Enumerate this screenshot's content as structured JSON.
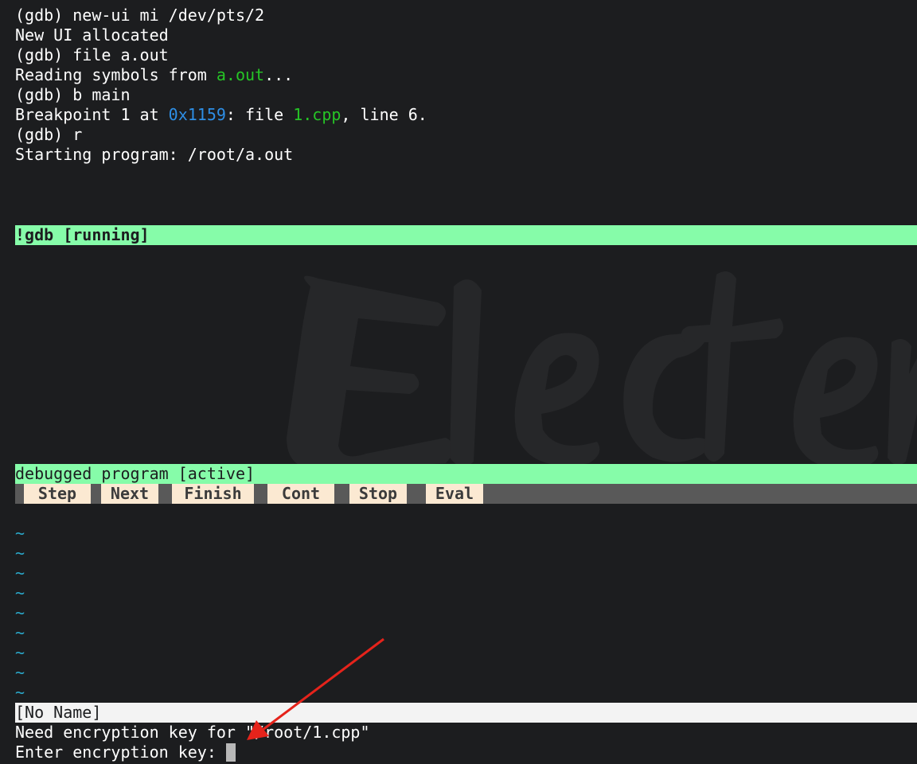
{
  "terminal": {
    "lines": [
      {
        "text": "(gdb) new-ui mi /dev/pts/2"
      },
      {
        "text": "New UI allocated"
      },
      {
        "text": "(gdb) file a.out"
      },
      {
        "pre": "Reading symbols from ",
        "file": "a.out",
        "post": "..."
      },
      {
        "text": "(gdb) b main"
      },
      {
        "pre": "Breakpoint 1 at ",
        "addr": "0x1159",
        "mid": ": file ",
        "file": "1.cpp",
        "post": ", line 6."
      },
      {
        "text": "(gdb) r"
      },
      {
        "text": "Starting program: /root/a.out"
      }
    ]
  },
  "gdb_status": "!gdb [running]",
  "program_status": "debugged program [active]",
  "toolbar": {
    "buttons": [
      "Step",
      "Next",
      "Finish",
      "Cont",
      "Stop",
      "Eval"
    ]
  },
  "editor": {
    "tilde": "~",
    "status_line": "[No Name]",
    "message": "Need encryption key for \"/root/1.cpp\"",
    "prompt": "Enter encryption key:"
  },
  "colors": {
    "background": "#1c1d1f",
    "status_green": "#86fca9",
    "filename_green": "#26c526",
    "address_blue": "#2e8fe6",
    "tilde_cyan": "#2aa7c8",
    "button_bg": "#fbe9d2",
    "toolbar_bg": "#595959",
    "annotation_arrow": "#e5231b"
  }
}
